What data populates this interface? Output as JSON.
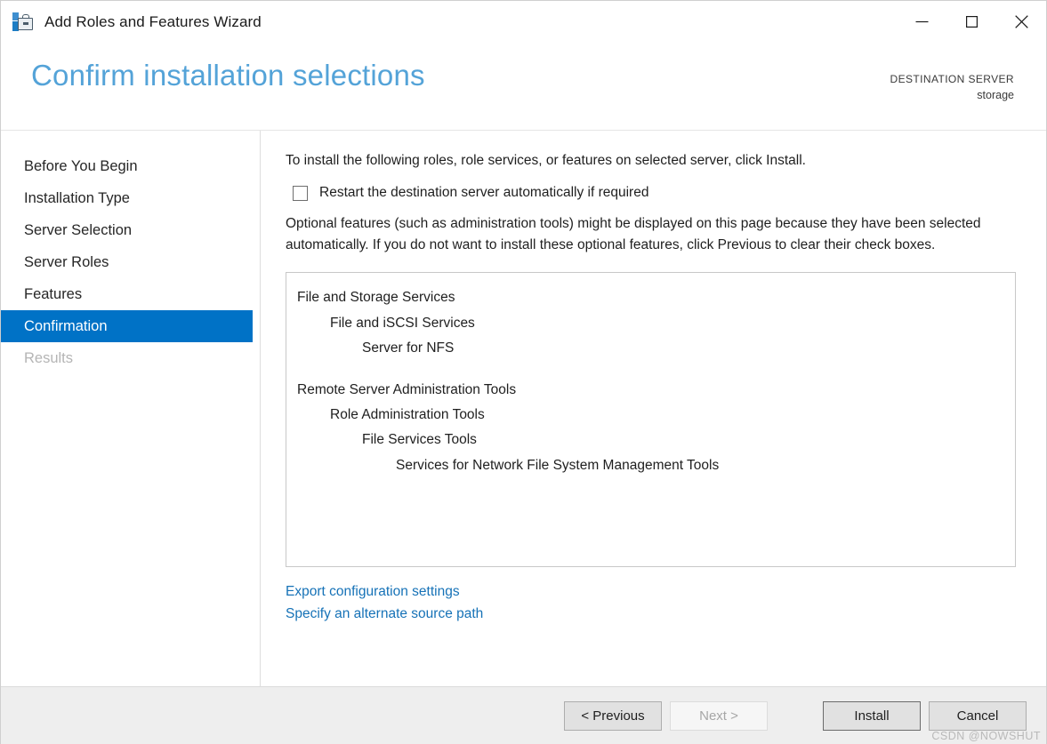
{
  "window": {
    "title": "Add Roles and Features Wizard",
    "icon": "server-toolbox-icon",
    "controls": {
      "minimize": "minimize-icon",
      "maximize": "maximize-icon",
      "close": "close-icon"
    }
  },
  "header": {
    "page_title": "Confirm installation selections",
    "destination_label": "DESTINATION SERVER",
    "destination_value": "storage",
    "title_color": "#54a3d8"
  },
  "sidebar": {
    "items": [
      {
        "label": "Before You Begin",
        "state": "normal"
      },
      {
        "label": "Installation Type",
        "state": "normal"
      },
      {
        "label": "Server Selection",
        "state": "normal"
      },
      {
        "label": "Server Roles",
        "state": "normal"
      },
      {
        "label": "Features",
        "state": "normal"
      },
      {
        "label": "Confirmation",
        "state": "selected"
      },
      {
        "label": "Results",
        "state": "disabled"
      }
    ],
    "selected_color": "#0072c6"
  },
  "content": {
    "intro": "To install the following roles, role services, or features on selected server, click Install.",
    "restart_checkbox": {
      "label": "Restart the destination server automatically if required",
      "checked": false
    },
    "optional_note": "Optional features (such as administration tools) might be displayed on this page because they have been selected automatically. If you do not want to install these optional features, click Previous to clear their check boxes.",
    "selections": [
      {
        "label": "File and Storage Services",
        "indent": 0
      },
      {
        "label": "File and iSCSI Services",
        "indent": 1
      },
      {
        "label": "Server for NFS",
        "indent": 2
      },
      {
        "label": "",
        "indent": 0,
        "spacer": true
      },
      {
        "label": "Remote Server Administration Tools",
        "indent": 0
      },
      {
        "label": "Role Administration Tools",
        "indent": 1
      },
      {
        "label": "File Services Tools",
        "indent": 2
      },
      {
        "label": "Services for Network File System Management Tools",
        "indent": 3
      }
    ],
    "links": [
      {
        "label": "Export configuration settings"
      },
      {
        "label": "Specify an alternate source path"
      }
    ],
    "link_color": "#1672b7"
  },
  "footer": {
    "buttons": [
      {
        "label": "< Previous",
        "state": "normal",
        "name": "previous-button"
      },
      {
        "label": "Next >",
        "state": "disabled",
        "name": "next-button"
      },
      {
        "label": "Install",
        "state": "primary",
        "name": "install-button"
      },
      {
        "label": "Cancel",
        "state": "normal",
        "name": "cancel-button"
      }
    ]
  },
  "watermark": "CSDN @NOWSHUT"
}
